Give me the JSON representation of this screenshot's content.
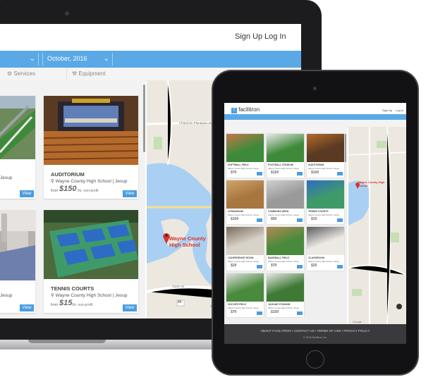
{
  "laptop": {
    "header": {
      "signup": "Sign Up",
      "login": "Log In"
    },
    "search": {
      "date": "October, 2016"
    },
    "filters": {
      "services": "Services",
      "equipment": "Equipment"
    },
    "cards": [
      {
        "name": "",
        "location": "Jesup",
        "from": "",
        "price": "",
        "note": "",
        "view": "View"
      },
      {
        "name": "AUDITORIUM",
        "location": "Wayne County High School | Jesup",
        "from": "from",
        "price": "$150",
        "note": "/hr, non-profit",
        "view": "View"
      },
      {
        "name": "",
        "location": "Jesup",
        "from": "",
        "price": "",
        "note": "",
        "view": "View"
      },
      {
        "name": "TENNIS COURTS",
        "location": "Wayne County High School | Jesup",
        "from": "from",
        "price": "$15",
        "note": "/hr, non-profit",
        "view": "View"
      }
    ],
    "map": {
      "road1": "Chapman Plantation Rd",
      "road2": "Glynn St",
      "road3": "Sunset Blvd",
      "route": "84",
      "pin_label_1": "Wayne County",
      "pin_label_2": "High School"
    }
  },
  "tablet": {
    "brand": "facilitron",
    "header": {
      "signup": "Sign Up",
      "login": "Log In"
    },
    "cards": [
      {
        "name": "SOFTBALL FIELD",
        "loc": "Wayne County High School | Jesup",
        "price": "$70"
      },
      {
        "name": "FOOTBALL STADIUM",
        "loc": "Wayne County High School | Jesup",
        "price": "$150"
      },
      {
        "name": "AUDITORIUM",
        "loc": "Wayne County High School | Jesup",
        "price": "$150"
      },
      {
        "name": "GYMNASIUM",
        "loc": "Wayne County High School | Jesup",
        "price": "$100"
      },
      {
        "name": "COMMONS AREA",
        "loc": "Wayne County High School | Jesup",
        "price": "$50"
      },
      {
        "name": "TENNIS COURTS",
        "loc": "Wayne County High School | Jesup",
        "price": "$15"
      },
      {
        "name": "CONFERENCE ROOM",
        "loc": "Wayne County High School | Jesup",
        "price": "$25"
      },
      {
        "name": "BASEBALL FIELD",
        "loc": "Wayne County High School | Jesup",
        "price": "$70"
      },
      {
        "name": "CLASSROOM",
        "loc": "Wayne County High School | Jesup",
        "price": "$25"
      },
      {
        "name": "SOCCER FIELD",
        "loc": "Wayne County High School | Jesup",
        "price": "$70"
      },
      {
        "name": "JAGUAR STADIUM",
        "loc": "Wayne County High School | Jesup",
        "price": "$150"
      }
    ],
    "map": {
      "pin_label": "Wayne County High School"
    },
    "footer": {
      "links": [
        "ABOUT FACILITRON",
        "CONTACT US",
        "TERMS OF USE",
        "PRIVACY POLICY"
      ],
      "copyright": "© 2016 Facilitron, Inc."
    }
  },
  "colors": {
    "accent": "#5aa9e6",
    "button": "#4a9de0",
    "pin": "#d6342a",
    "footer": "#3a3a3c"
  }
}
